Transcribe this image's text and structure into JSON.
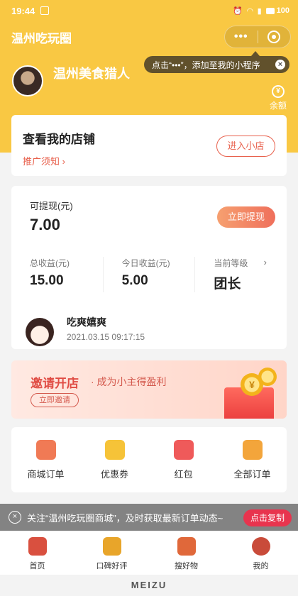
{
  "status_bar": {
    "time": "19:44",
    "battery": "100"
  },
  "nav": {
    "title": "温州吃玩圈",
    "more": "•••"
  },
  "tip": {
    "text": "点击“•••”，添加至我的小程序",
    "close": "×"
  },
  "profile": {
    "name": "温州美食猎人",
    "balance_label": "余额",
    "balance_glyph": "¥"
  },
  "shop": {
    "title": "查看我的店铺",
    "link": "推广须知",
    "enter_button": "进入小店"
  },
  "income": {
    "withdrawable_label": "可提现(元)",
    "withdrawable_value": "7.00",
    "withdraw_button": "立即提现",
    "stats": [
      {
        "label": "总收益(元)",
        "value": "15.00"
      },
      {
        "label": "今日收益(元)",
        "value": "5.00"
      },
      {
        "label": "当前等级",
        "value": "团长"
      }
    ]
  },
  "user": {
    "name": "吃爽嬉爽",
    "time": "2021.03.15 09:17:15"
  },
  "banner": {
    "title": "邀请开店",
    "subtitle": "· 成为小主得盈利",
    "button": "立即邀请",
    "coin_glyph": "¥"
  },
  "menu": [
    {
      "label": "商城订单",
      "color": "#f07a55",
      "icon": "order-icon"
    },
    {
      "label": "优惠券",
      "color": "#f6c338",
      "icon": "coupon-icon"
    },
    {
      "label": "红包",
      "color": "#ef5a5a",
      "icon": "red-packet-icon"
    },
    {
      "label": "全部订单",
      "color": "#f3a53b",
      "icon": "all-orders-icon"
    }
  ],
  "toast": {
    "text": "关注“温州吃玩圈商城”，及时获取最新订单动态~",
    "button": "点击复制",
    "close": "×"
  },
  "tabs": [
    {
      "label": "首页",
      "color": "#d9503f",
      "icon": "home-icon"
    },
    {
      "label": "口碑好评",
      "color": "#e8a52a",
      "icon": "reviews-icon"
    },
    {
      "label": "搜好物",
      "color": "#e0683a",
      "icon": "search-goods-icon"
    },
    {
      "label": "我的",
      "color": "#c94b3a",
      "icon": "profile-icon"
    }
  ],
  "device_brand": "MEIZU"
}
